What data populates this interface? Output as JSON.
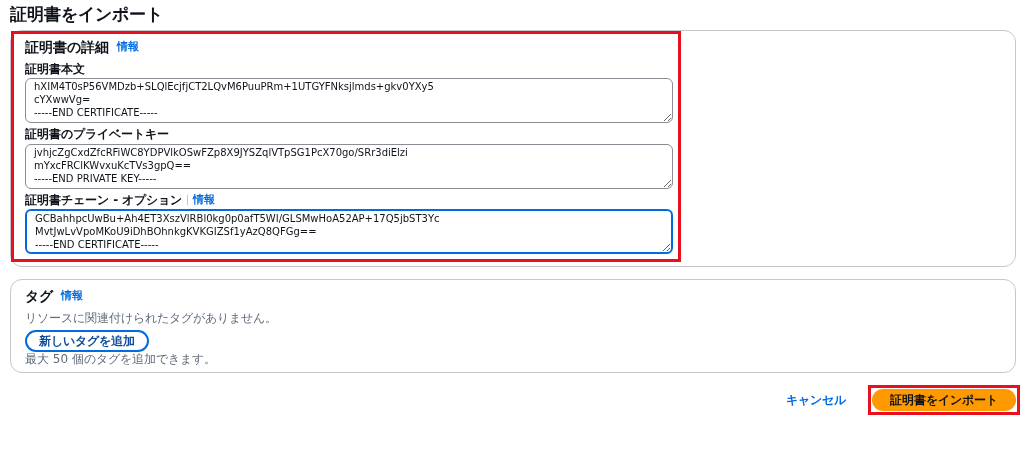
{
  "page_title": "証明書をインポート",
  "details": {
    "title": "証明書の詳細",
    "info": "情報",
    "highlighted": true,
    "fields": [
      {
        "label": "証明書本文",
        "focused": false,
        "value": "hXIM4T0sP56VMDzb+SLQlEcjfjCT2LQvM6PuuPRm+1UTGYFNksjlmds+gkv0YXy5\ncYXwwVg=\n-----END CERTIFICATE-----"
      },
      {
        "label": "証明書のプライベートキー",
        "focused": false,
        "value": "jvhjcZgCxdZfcRFiWC8YDPVlkOSwFZp8X9JYSZqlVTpSG1PcX70go/SRr3diElzi\nmYxcFRClKWvxuKcTVs3gpQ==\n-----END PRIVATE KEY-----"
      },
      {
        "label": "証明書チェーン - オプション",
        "info": "情報",
        "focused": true,
        "value": "GCBahhpcUwBu+Ah4ET3XszVlRBl0kg0p0afT5WI/GLSMwHoA52AP+17Q5jbST3Yc\nMvtJwLvVpoMKoU9iDhBOhnkgKVKGIZSf1yAzQ8QFGg==\n-----END CERTIFICATE-----"
      }
    ]
  },
  "tags": {
    "title": "タグ",
    "info": "情報",
    "empty_text": "リソースに関連付けられたタグがありません。",
    "add_button": "新しいタグを追加",
    "hint": "最大 50 個のタグを追加できます。"
  },
  "footer": {
    "cancel": "キャンセル",
    "submit": "証明書をインポート",
    "submit_highlighted": true
  }
}
